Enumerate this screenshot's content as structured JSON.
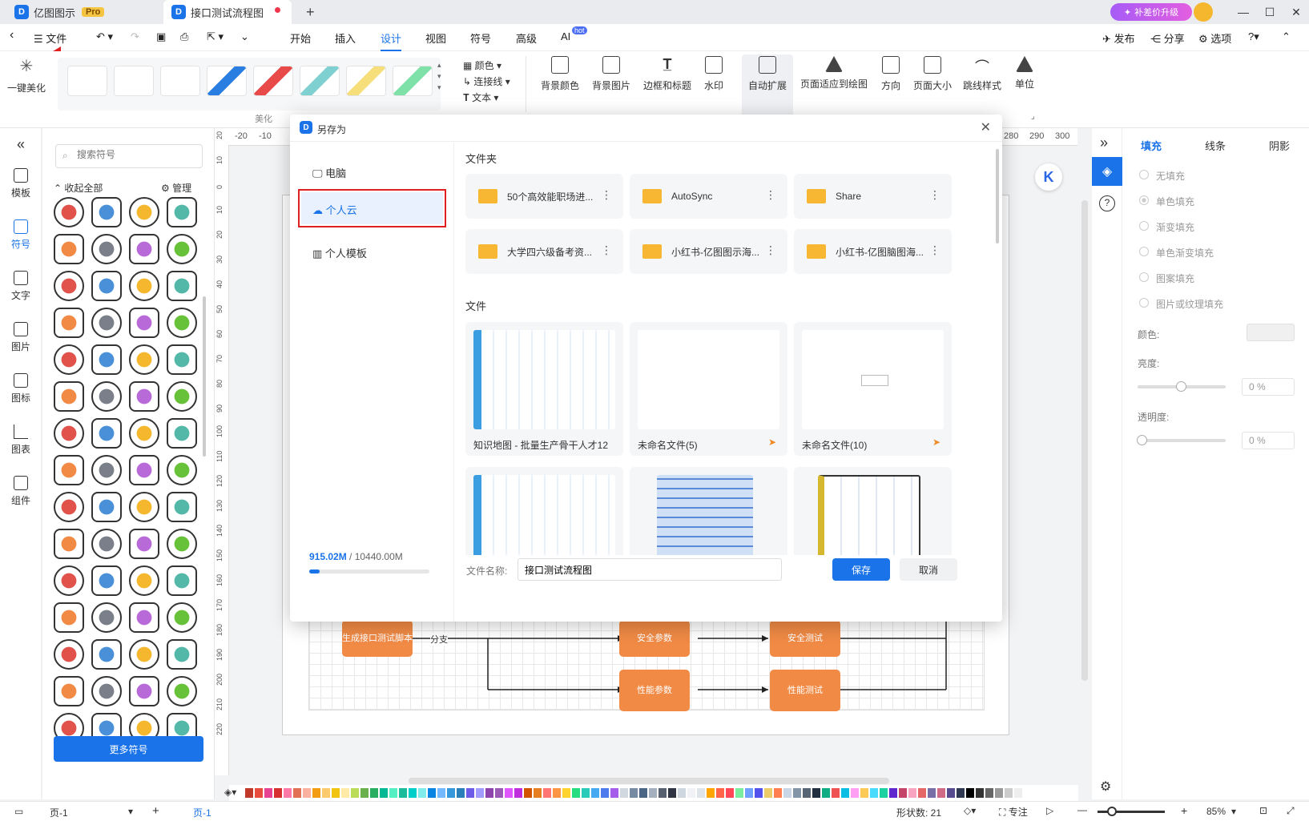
{
  "titlebar": {
    "app_name": "亿图图示",
    "pro_badge": "Pro",
    "doc_tab": "接口测试流程图",
    "new_tab": "+",
    "upgrade": "补差价升级"
  },
  "menubar": {
    "file": "文件",
    "items": [
      "开始",
      "插入",
      "设计",
      "视图",
      "符号",
      "高级",
      "AI"
    ],
    "ai_badge": "hot",
    "right": [
      "发布",
      "分享",
      "选项"
    ]
  },
  "ribbon": {
    "beautify_one_click": "一键美化",
    "section_label": "美化",
    "color": "颜色",
    "connector": "连接线",
    "text": "文本",
    "buttons": [
      "背景颜色",
      "背景图片",
      "边框和标题",
      "水印",
      "自动扩展",
      "页面适应到绘图",
      "方向",
      "页面大小",
      "跳线样式",
      "单位"
    ]
  },
  "leftbar": {
    "items": [
      "模板",
      "符号",
      "文字",
      "图片",
      "图标",
      "图表",
      "组件"
    ]
  },
  "sympanel": {
    "search_placeholder": "搜索符号",
    "collapse_all": "收起全部",
    "manage": "管理",
    "more_symbols": "更多符号"
  },
  "ruler_top": [
    "-20",
    "-10",
    "280",
    "290",
    "300"
  ],
  "ruler_left": [
    "20",
    "10",
    "0",
    "10",
    "20",
    "30",
    "40",
    "50",
    "60",
    "70",
    "80",
    "90",
    "100",
    "110",
    "120",
    "130",
    "140",
    "150",
    "160",
    "170",
    "180",
    "190",
    "200",
    "210",
    "220"
  ],
  "diagram": {
    "nodes": {
      "gen_script": "生成接口测试脚本",
      "security_params": "安全参数",
      "security_test": "安全测试",
      "perf_params": "性能参数",
      "perf_test": "性能测试"
    },
    "branch_label": "分支"
  },
  "rightpanel": {
    "tabs": [
      "填充",
      "线条",
      "阴影"
    ],
    "fill_options": [
      "无填充",
      "单色填充",
      "渐变填充",
      "单色渐变填充",
      "图案填充",
      "图片或纹理填充"
    ],
    "color_label": "颜色:",
    "brightness_label": "亮度:",
    "brightness_value": "0 %",
    "transparency_label": "透明度:",
    "transparency_value": "0 %"
  },
  "statusbar": {
    "page_select": "页-1",
    "page_tab": "页-1",
    "shape_count": "形状数: 21",
    "focus": "专注",
    "zoom": "85%"
  },
  "dialog": {
    "title": "另存为",
    "nav": [
      "电脑",
      "个人云",
      "个人模板"
    ],
    "selected_nav": "个人云",
    "storage_used": "915.02M",
    "storage_total": " / 10440.00M",
    "storage_fraction": 0.088,
    "folders_heading": "文件夹",
    "folders": [
      "50个高效能职场进...",
      "AutoSync",
      "Share",
      "大学四六级备考资...",
      "小红书-亿图图示海...",
      "小红书-亿图脑图海..."
    ],
    "files_heading": "文件",
    "files": [
      "知识地图 - 批量生产骨干人才12",
      "未命名文件(5)",
      "未命名文件(10)"
    ],
    "filename_label": "文件名称:",
    "filename_value": "接口测试流程图",
    "save": "保存",
    "cancel": "取消"
  },
  "colors": {
    "accent": "#1a73e8",
    "node": "#f08a45",
    "highlight_border": "#e02020",
    "folder": "#f7b733"
  }
}
